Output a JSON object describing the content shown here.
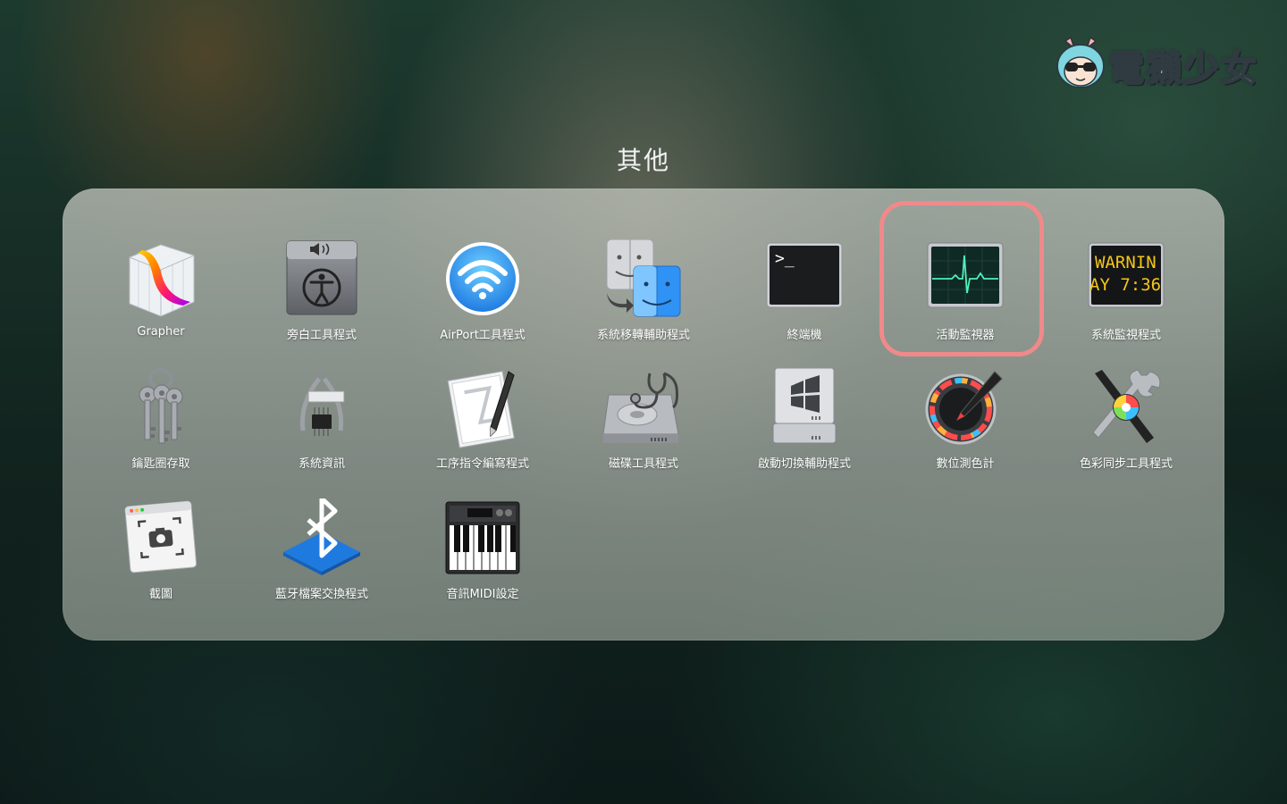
{
  "watermark": {
    "text": "電獺少女"
  },
  "folder": {
    "title": "其他",
    "apps": [
      {
        "label": "Grapher",
        "icon": "grapher-icon"
      },
      {
        "label": "旁白工具程式",
        "icon": "voiceover-utility-icon"
      },
      {
        "label": "AirPort工具程式",
        "icon": "airport-utility-icon"
      },
      {
        "label": "系統移轉輔助程式",
        "icon": "migration-assistant-icon"
      },
      {
        "label": "終端機",
        "icon": "terminal-icon"
      },
      {
        "label": "活動監視器",
        "icon": "activity-monitor-icon"
      },
      {
        "label": "系統監視程式",
        "icon": "console-icon"
      },
      {
        "label": "鑰匙圈存取",
        "icon": "keychain-access-icon"
      },
      {
        "label": "系統資訊",
        "icon": "system-information-icon"
      },
      {
        "label": "工序指令編寫程式",
        "icon": "script-editor-icon"
      },
      {
        "label": "磁碟工具程式",
        "icon": "disk-utility-icon"
      },
      {
        "label": "啟動切換輔助程式",
        "icon": "boot-camp-assistant-icon"
      },
      {
        "label": "數位測色計",
        "icon": "digital-color-meter-icon"
      },
      {
        "label": "色彩同步工具程式",
        "icon": "colorsync-utility-icon"
      },
      {
        "label": "截圖",
        "icon": "screenshot-icon"
      },
      {
        "label": "藍牙檔案交換程式",
        "icon": "bluetooth-file-exchange-icon"
      },
      {
        "label": "音訊MIDI設定",
        "icon": "audio-midi-setup-icon"
      }
    ]
  },
  "terminal_prompt": ">_",
  "console_text": {
    "line1": "WARNIN",
    "line2": "AY 7:36"
  },
  "colors": {
    "highlight": "#f08a8a",
    "console_text": "#f5c518"
  }
}
